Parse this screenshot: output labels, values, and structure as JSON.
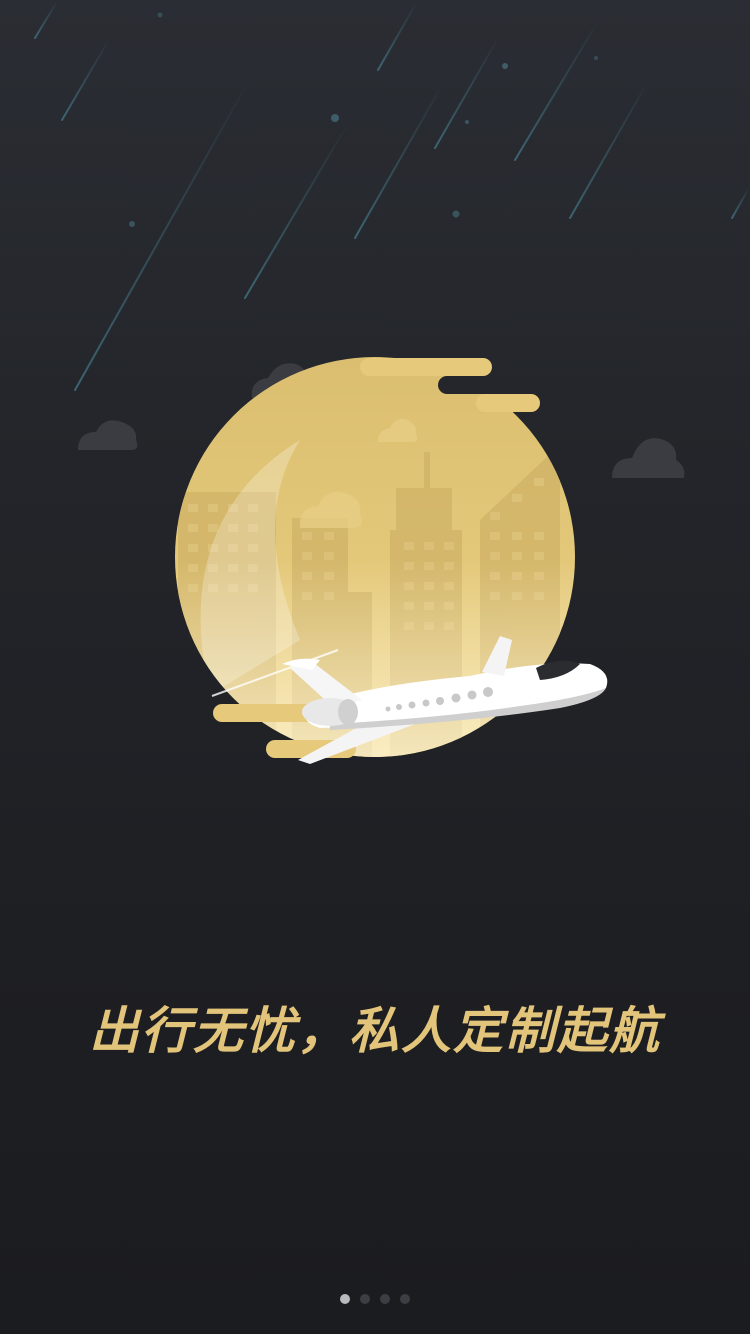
{
  "onboarding": {
    "slogan": "出行无忧，私人定制起航",
    "current_page": 1,
    "page_count": 4
  },
  "colors": {
    "background": "#23252a",
    "accent_gold": "#e2c47a",
    "moon": "#dfc173",
    "dot_active": "#b9babd",
    "dot_inactive": "#3c3e44"
  },
  "icons": {
    "hero": "private-jet-moon-city-illustration"
  }
}
